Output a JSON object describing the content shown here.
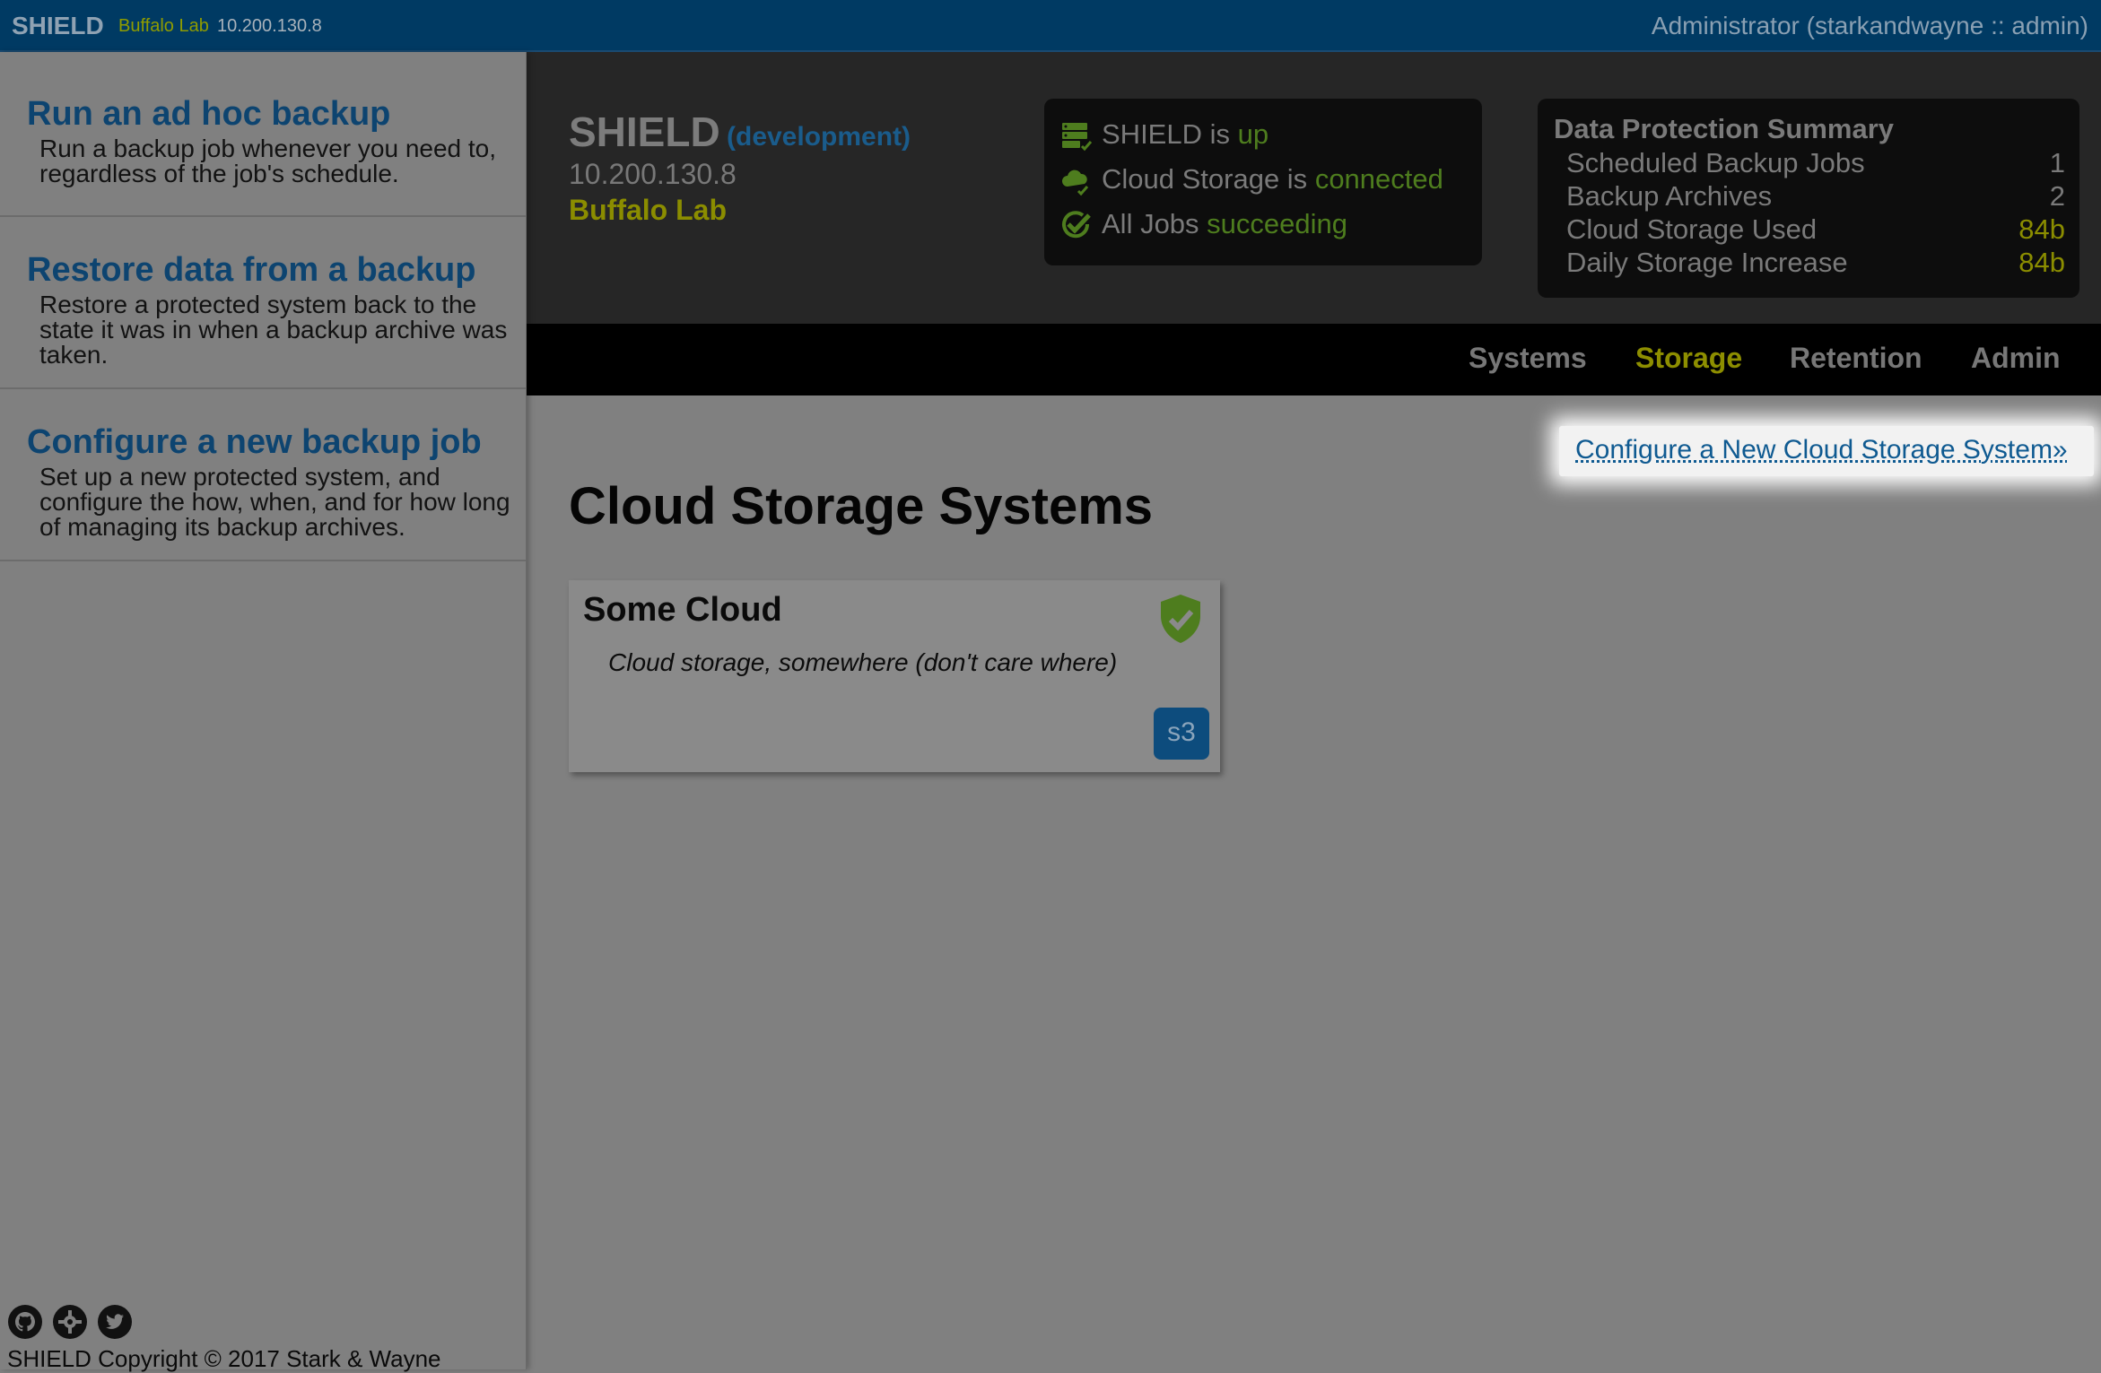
{
  "topbar": {
    "brand": "SHIELD",
    "lab": "Buffalo Lab",
    "ip": "10.200.130.8",
    "user": "Administrator (starkandwayne :: admin)"
  },
  "sidebar": {
    "items": [
      {
        "title": "Run an ad hoc backup",
        "desc": "Run a backup job whenever you need to, regardless of the job's schedule."
      },
      {
        "title": "Restore data from a backup",
        "desc": "Restore a protected system back to the state it was in when a backup archive was taken."
      },
      {
        "title": "Configure a new backup job",
        "desc": "Set up a new protected system, and configure the how, when, and for how long of managing its backup archives."
      }
    ],
    "footer_icons": [
      "github-icon",
      "gear-icon",
      "twitter-icon"
    ],
    "copyright": "SHIELD Copyright © 2017 Stark & Wayne"
  },
  "header": {
    "name": "SHIELD",
    "env": "(development)",
    "ip": "10.200.130.8",
    "lab": "Buffalo Lab",
    "status": [
      {
        "icon": "server-icon",
        "prefix": "SHIELD is ",
        "value": "up"
      },
      {
        "icon": "cloud-icon",
        "prefix": "Cloud Storage is ",
        "value": "connected"
      },
      {
        "icon": "check-badge-icon",
        "prefix": "All Jobs ",
        "value": "succeeding"
      }
    ],
    "summary": {
      "title": "Data Protection Summary",
      "rows": [
        {
          "label": "Scheduled Backup Jobs",
          "value": "1"
        },
        {
          "label": "Backup Archives",
          "value": "2"
        },
        {
          "label": "Cloud Storage Used",
          "value": "84b"
        },
        {
          "label": "Daily Storage Increase",
          "value": "84b"
        }
      ]
    }
  },
  "nav": {
    "tabs": [
      "Systems",
      "Storage",
      "Retention",
      "Admin"
    ],
    "active": "Storage"
  },
  "main": {
    "config_link": "Configure a New Cloud Storage System»",
    "title": "Cloud Storage Systems",
    "cards": [
      {
        "name": "Some Cloud",
        "desc": "Cloud storage, somewhere (don't care where)",
        "plugin": "s3",
        "status_icon": "shield-check-icon"
      }
    ]
  },
  "colors": {
    "topbar_bg": "#003a63",
    "accent_yellow": "#8b8d00",
    "link_blue": "#0f5a91",
    "good_green": "#4e7d1e",
    "header_bg": "#262626",
    "nav_bg": "#000000"
  }
}
